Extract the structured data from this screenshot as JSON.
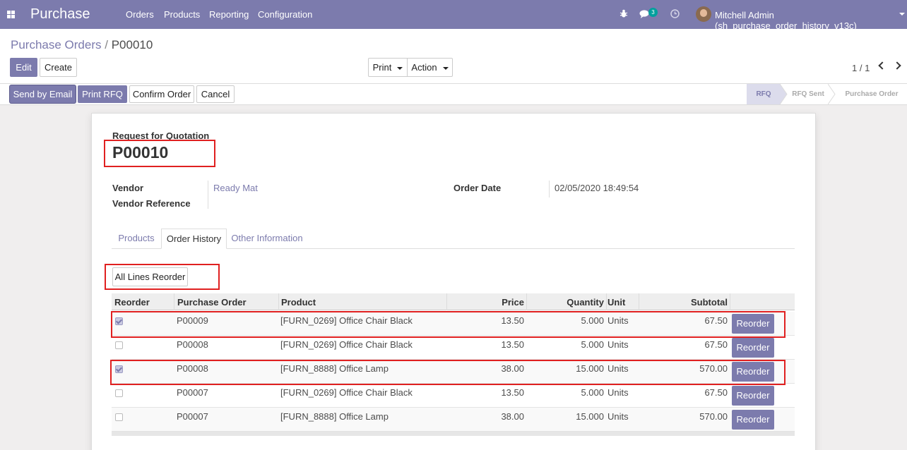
{
  "navbar": {
    "brand": "Purchase",
    "menu": [
      "Orders",
      "Products",
      "Reporting",
      "Configuration"
    ],
    "messages_badge": "3",
    "user": "Mitchell Admin (sh_purchase_order_history_v13c)"
  },
  "breadcrumb": {
    "parent": "Purchase Orders",
    "separator": "/",
    "current": "P00010"
  },
  "toolbar": {
    "edit": "Edit",
    "create": "Create",
    "print": "Print",
    "action": "Action"
  },
  "pager": {
    "value": "1 / 1"
  },
  "statusbar": {
    "buttons": [
      "Send by Email",
      "Print RFQ",
      "Confirm Order",
      "Cancel"
    ],
    "stages": [
      "RFQ",
      "RFQ Sent",
      "Purchase Order"
    ],
    "active_stage": "RFQ"
  },
  "form": {
    "doc_type": "Request for Quotation",
    "name": "P00010",
    "vendor_label": "Vendor",
    "vendor_value": "Ready Mat",
    "vendor_ref_label": "Vendor Reference",
    "order_date_label": "Order Date",
    "order_date_value": "02/05/2020 18:49:54"
  },
  "tabs": [
    "Products",
    "Order History",
    "Other Information"
  ],
  "active_tab": "Order History",
  "all_lines_reorder": "All Lines Reorder",
  "table": {
    "headers": [
      "Reorder",
      "Purchase Order",
      "Product",
      "Price",
      "Quantity",
      "Unit",
      "Subtotal"
    ],
    "button_label": "Reorder",
    "rows": [
      {
        "checked": true,
        "po": "P00009",
        "product": "[FURN_0269] Office Chair Black",
        "price": "13.50",
        "qty": "5.000",
        "unit": "Units",
        "subtotal": "67.50"
      },
      {
        "checked": false,
        "po": "P00008",
        "product": "[FURN_0269] Office Chair Black",
        "price": "13.50",
        "qty": "5.000",
        "unit": "Units",
        "subtotal": "67.50"
      },
      {
        "checked": true,
        "po": "P00008",
        "product": "[FURN_8888] Office Lamp",
        "price": "38.00",
        "qty": "15.000",
        "unit": "Units",
        "subtotal": "570.00"
      },
      {
        "checked": false,
        "po": "P00007",
        "product": "[FURN_0269] Office Chair Black",
        "price": "13.50",
        "qty": "5.000",
        "unit": "Units",
        "subtotal": "67.50"
      },
      {
        "checked": false,
        "po": "P00007",
        "product": "[FURN_8888] Office Lamp",
        "price": "38.00",
        "qty": "15.000",
        "unit": "Units",
        "subtotal": "570.00"
      }
    ]
  },
  "colors": {
    "brand": "#7c7bad",
    "highlight": "#e02020"
  }
}
